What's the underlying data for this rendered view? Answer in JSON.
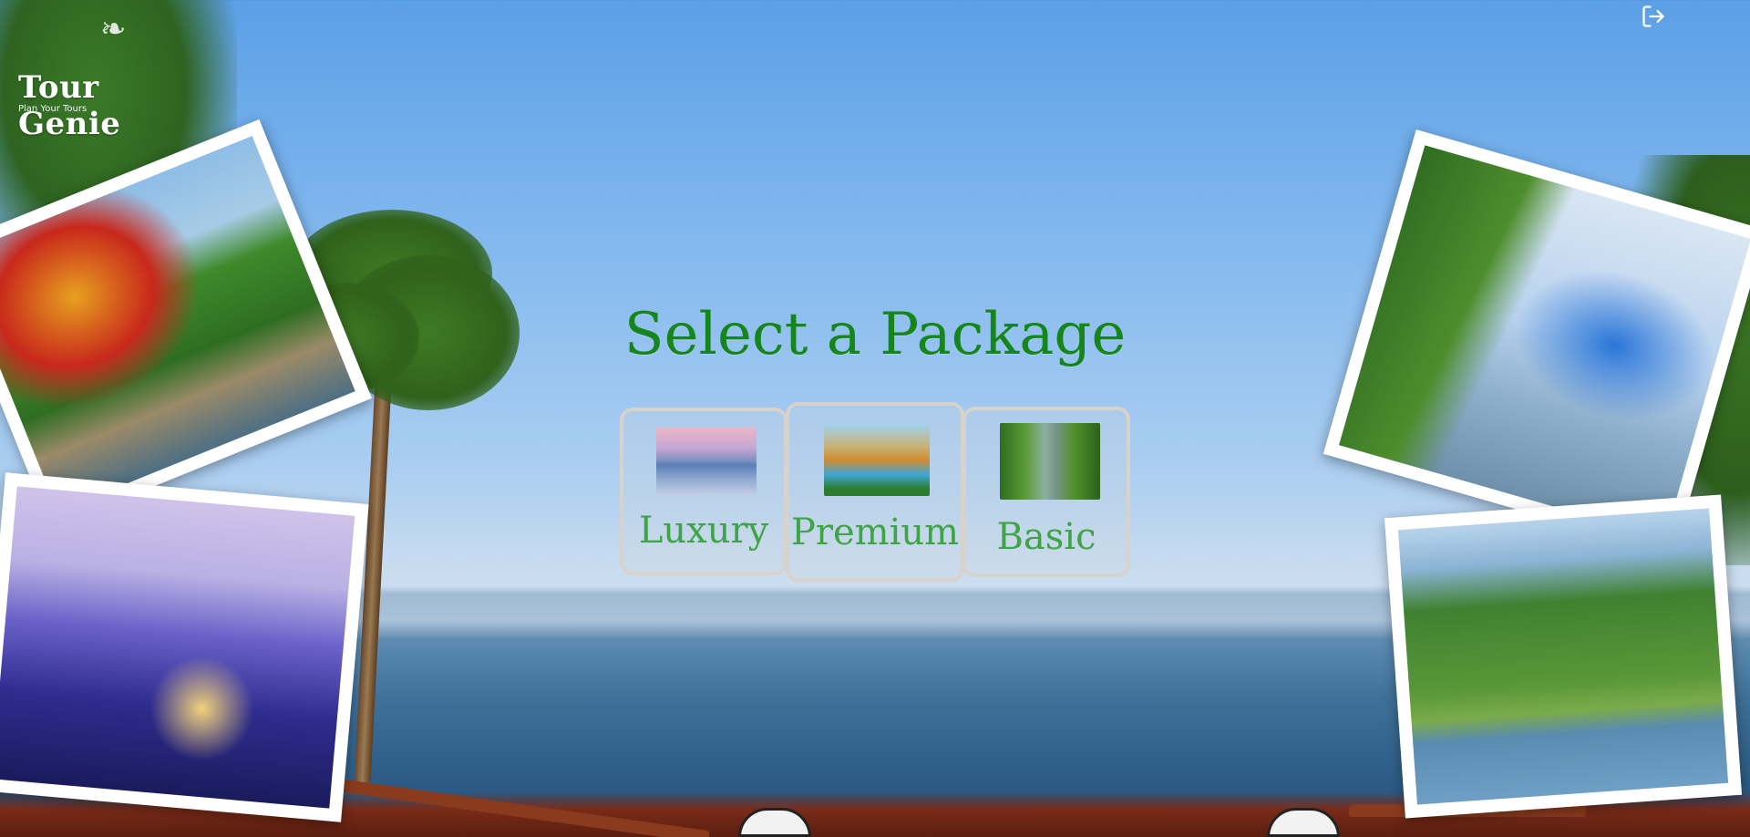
{
  "logo": {
    "title": "Tour Genie",
    "tagline": "Plan Your Tours"
  },
  "header": {
    "logout_icon": "logout-icon"
  },
  "main": {
    "heading": "Select a Package",
    "packages": [
      {
        "label": "Luxury",
        "image": "luxury-resort-image"
      },
      {
        "label": "Premium",
        "image": "premium-pool-resort-image"
      },
      {
        "label": "Basic",
        "image": "basic-backwater-boat-image"
      }
    ]
  },
  "colors": {
    "heading": "#15861c",
    "package_label": "#3ea446",
    "card_border": "#d8d2cc"
  }
}
